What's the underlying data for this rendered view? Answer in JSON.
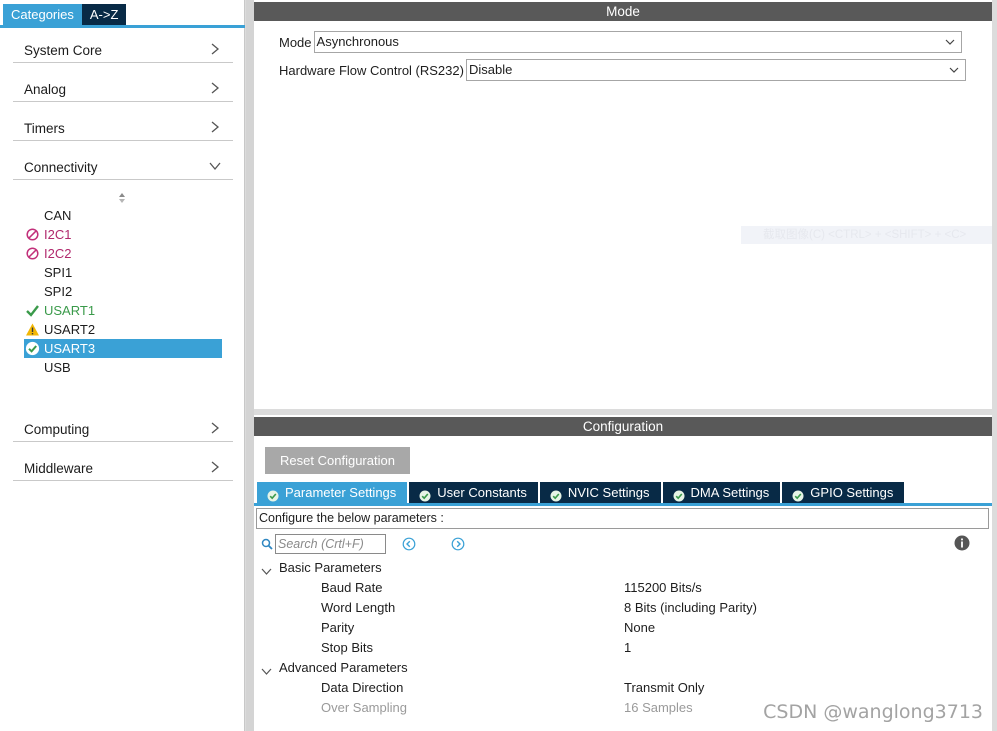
{
  "left_tabs": {
    "categories": "Categories",
    "a_to_z": "A->Z"
  },
  "categories": {
    "system_core": "System Core",
    "analog": "Analog",
    "timers": "Timers",
    "connectivity": "Connectivity",
    "computing": "Computing",
    "middleware": "Middleware"
  },
  "peripherals": [
    {
      "label": "CAN",
      "status": "none"
    },
    {
      "label": "I2C1",
      "status": "disabled"
    },
    {
      "label": "I2C2",
      "status": "disabled"
    },
    {
      "label": "SPI1",
      "status": "none"
    },
    {
      "label": "SPI2",
      "status": "none"
    },
    {
      "label": "USART1",
      "status": "configured"
    },
    {
      "label": "USART2",
      "status": "warning"
    },
    {
      "label": "USART3",
      "status": "selected"
    },
    {
      "label": "USB",
      "status": "none"
    }
  ],
  "mode_panel": {
    "title": "Mode",
    "mode_label": "Mode",
    "mode_value": "Asynchronous",
    "flow_label": "Hardware Flow Control (RS232)",
    "flow_value": "Disable",
    "capture_hint": "截取图像(C)    <CTRL> + <SHIFT> + <C>"
  },
  "config_panel": {
    "title": "Configuration",
    "reset_button": "Reset Configuration",
    "tabs": {
      "parameter": "Parameter Settings",
      "user_constants": "User Constants",
      "nvic": "NVIC Settings",
      "dma": "DMA Settings",
      "gpio": "GPIO Settings"
    },
    "description": "Configure the below parameters :",
    "search_placeholder": "Search (Crtl+F)",
    "groups": {
      "basic": "Basic Parameters",
      "advanced": "Advanced Parameters"
    },
    "params": {
      "baud_rate": {
        "name": "Baud Rate",
        "value": "115200 Bits/s"
      },
      "word_length": {
        "name": "Word Length",
        "value": "8 Bits (including Parity)"
      },
      "parity": {
        "name": "Parity",
        "value": "None"
      },
      "stop_bits": {
        "name": "Stop Bits",
        "value": "1"
      },
      "data_direction": {
        "name": "Data Direction",
        "value": "Transmit Only"
      },
      "over_sampling": {
        "name": "Over Sampling",
        "value": "16 Samples"
      }
    }
  },
  "watermark": "CSDN @wanglong3713",
  "colors": {
    "accent": "#3aa1d6",
    "dark_tab": "#082a46",
    "header": "#595959",
    "ok": "#3a9a4a",
    "error": "#b0286c",
    "warning": "#f2b705"
  }
}
